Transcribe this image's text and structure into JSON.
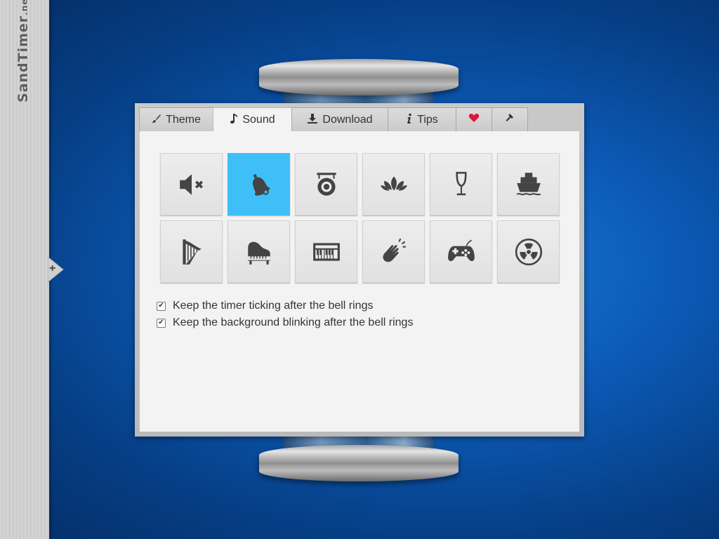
{
  "logo": {
    "text_main": "SandTimer",
    "text_suffix": ".net"
  },
  "sidebar": {
    "expand_label": "+"
  },
  "tabs": [
    {
      "id": "theme",
      "label": "Theme",
      "icon": "brush-icon"
    },
    {
      "id": "sound",
      "label": "Sound",
      "icon": "music-note-icon",
      "active": true
    },
    {
      "id": "download",
      "label": "Download",
      "icon": "download-icon"
    },
    {
      "id": "tips",
      "label": "Tips",
      "icon": "info-icon"
    },
    {
      "id": "favorite",
      "label": "",
      "icon": "heart-icon"
    },
    {
      "id": "tools",
      "label": "",
      "icon": "hammer-icon"
    }
  ],
  "sounds": [
    {
      "name": "mute",
      "icon": "mute-speaker-icon",
      "selected": false
    },
    {
      "name": "bell",
      "icon": "bell-icon",
      "selected": true
    },
    {
      "name": "gong",
      "icon": "gong-icon",
      "selected": false
    },
    {
      "name": "lotus",
      "icon": "lotus-icon",
      "selected": false
    },
    {
      "name": "glass",
      "icon": "wine-glass-icon",
      "selected": false
    },
    {
      "name": "ship",
      "icon": "ship-icon",
      "selected": false
    },
    {
      "name": "harp",
      "icon": "harp-icon",
      "selected": false
    },
    {
      "name": "piano",
      "icon": "piano-icon",
      "selected": false
    },
    {
      "name": "keyboard",
      "icon": "keyboard-icon",
      "selected": false
    },
    {
      "name": "clap",
      "icon": "clapping-hands-icon",
      "selected": false
    },
    {
      "name": "gamepad",
      "icon": "gamepad-icon",
      "selected": false
    },
    {
      "name": "radiation",
      "icon": "radiation-icon",
      "selected": false
    }
  ],
  "options": {
    "keep_ticking": {
      "label": "Keep the timer ticking after the bell rings",
      "checked": true
    },
    "keep_blinking": {
      "label": "Keep the background blinking after the bell rings",
      "checked": true
    }
  },
  "colors": {
    "accent": "#3fbff8",
    "background": "#0c5bb8",
    "heart": "#e0143c"
  }
}
